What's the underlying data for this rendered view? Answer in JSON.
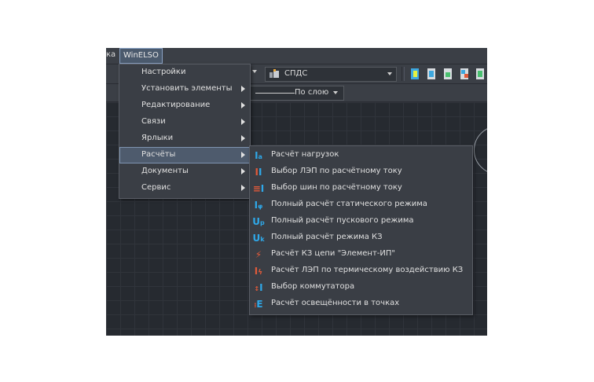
{
  "menubar": {
    "prev_label": "ка",
    "active_label": "WinELSO"
  },
  "toolbar": {
    "layer_name": "СПДС",
    "lineweight_label": "По слою"
  },
  "colors": {
    "accent_blue": "#2fa8e8",
    "accent_red": "#e05a3a",
    "menu_bg": "#3a3e45",
    "highlight": "#4e5b6d"
  },
  "menu": {
    "items": [
      {
        "label": "Настройки",
        "submenu": false
      },
      {
        "label": "Установить элементы",
        "submenu": true
      },
      {
        "label": "Редактирование",
        "submenu": true
      },
      {
        "label": "Связи",
        "submenu": true
      },
      {
        "label": "Ярлыки",
        "submenu": true
      },
      {
        "label": "Расчёты",
        "submenu": true
      },
      {
        "label": "Документы",
        "submenu": true
      },
      {
        "label": "Сервис",
        "submenu": true
      }
    ],
    "active_index": 5
  },
  "submenu": {
    "items": [
      {
        "label": "Расчёт нагрузок",
        "icon": "load-calc-icon"
      },
      {
        "label": "Выбор ЛЭП по расчётному току",
        "icon": "line-select-icon"
      },
      {
        "label": "Выбор шин по расчётному току",
        "icon": "bus-select-icon"
      },
      {
        "label": "Полный расчёт статического режима",
        "icon": "static-mode-icon"
      },
      {
        "label": "Полный расчёт пускового режима",
        "icon": "start-mode-icon"
      },
      {
        "label": "Полный расчёт режима КЗ",
        "icon": "short-circuit-mode-icon"
      },
      {
        "label": "Расчёт КЗ цепи \"Элемент-ИП\"",
        "icon": "lightning-icon"
      },
      {
        "label": "Расчёт ЛЭП по термическому воздействию КЗ",
        "icon": "thermal-icon"
      },
      {
        "label": "Выбор коммутатора",
        "icon": "switch-select-icon"
      },
      {
        "label": "Расчёт освещённости в точках",
        "icon": "illumination-icon"
      }
    ]
  }
}
